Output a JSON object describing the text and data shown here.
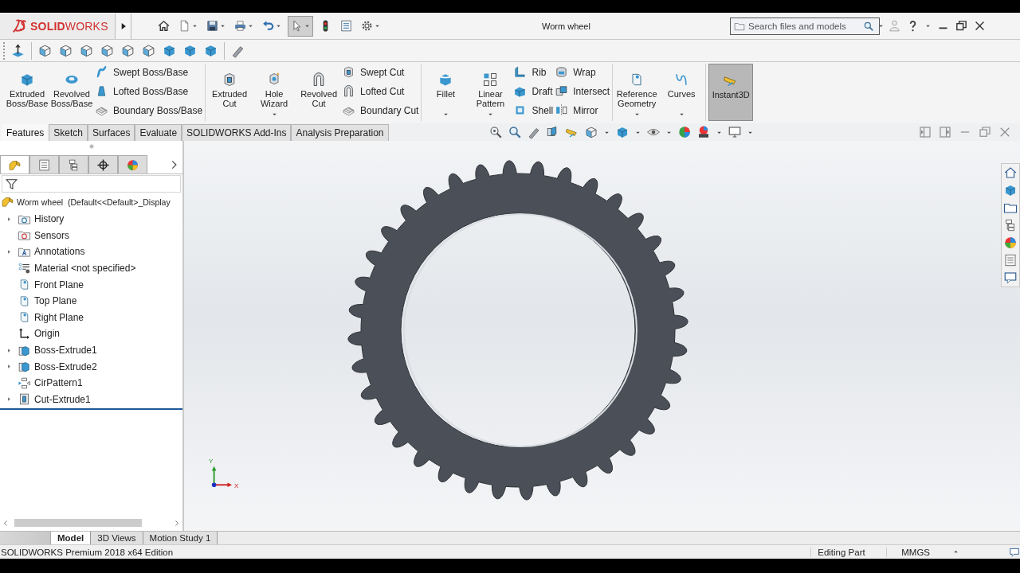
{
  "title_bar": {
    "logo": "**SOLID**WORKS",
    "title": "Worm wheel",
    "search": {
      "placeholder": "Search files and models"
    }
  },
  "quick_access": [
    {
      "dropdown": false,
      "pressed": false
    },
    {
      "dropdown": true,
      "pressed": false
    },
    {
      "dropdown": true,
      "pressed": false
    },
    {
      "dropdown": true,
      "pressed": false
    },
    {
      "dropdown": true,
      "pressed": false
    },
    {
      "dropdown": true,
      "pressed": true
    },
    {
      "dropdown": false,
      "pressed": false
    },
    {
      "dropdown": false,
      "pressed": false
    },
    {
      "dropdown": true,
      "pressed": false
    }
  ],
  "ribbon": {
    "groups": [
      {
        "items": [
          {
            "kind": "large",
            "label": "Extruded Boss/Base",
            "dropdown": false,
            "selected": false
          },
          {
            "kind": "large",
            "label": "Revolved Boss/Base",
            "dropdown": false,
            "selected": false
          },
          {
            "kind": "stack",
            "items": [
              {
                "label": "Swept Boss/Base"
              },
              {
                "label": "Lofted Boss/Base"
              },
              {
                "label": "Boundary Boss/Base"
              }
            ]
          }
        ]
      },
      {
        "items": [
          {
            "kind": "large",
            "label": "Extruded Cut",
            "dropdown": false,
            "selected": false
          },
          {
            "kind": "large",
            "label": "Hole Wizard",
            "dropdown": true,
            "selected": false
          },
          {
            "kind": "large",
            "label": "Revolved Cut",
            "dropdown": false,
            "selected": false
          },
          {
            "kind": "stack",
            "items": [
              {
                "label": "Swept Cut"
              },
              {
                "label": "Lofted Cut"
              },
              {
                "label": "Boundary Cut"
              }
            ]
          }
        ]
      },
      {
        "items": [
          {
            "kind": "large",
            "label": "Fillet",
            "dropdown": true,
            "selected": false
          },
          {
            "kind": "large",
            "label": "Linear Pattern",
            "dropdown": true,
            "selected": false
          },
          {
            "kind": "stack",
            "items": [
              {
                "label": "Rib"
              },
              {
                "label": "Draft"
              },
              {
                "label": "Shell"
              }
            ]
          },
          {
            "kind": "stack",
            "items": [
              {
                "label": "Wrap"
              },
              {
                "label": "Intersect"
              },
              {
                "label": "Mirror"
              }
            ]
          }
        ]
      },
      {
        "items": [
          {
            "kind": "large",
            "label": "Reference Geometry",
            "dropdown": true,
            "selected": false
          },
          {
            "kind": "large",
            "label": "Curves",
            "dropdown": true,
            "selected": false
          }
        ]
      },
      {
        "items": [
          {
            "kind": "large",
            "label": "Instant3D",
            "dropdown": false,
            "selected": true
          }
        ]
      }
    ]
  },
  "command_tabs": [
    {
      "label": "Features",
      "selected": true
    },
    {
      "label": "Sketch",
      "selected": false
    },
    {
      "label": "Surfaces",
      "selected": false
    },
    {
      "label": "Evaluate",
      "selected": false
    },
    {
      "label": "SOLIDWORKS Add-Ins",
      "selected": false
    },
    {
      "label": "Analysis Preparation",
      "selected": false
    }
  ],
  "panel_tabs": [
    {
      "selected": true
    },
    {
      "selected": false
    },
    {
      "selected": false
    },
    {
      "selected": false
    },
    {
      "selected": false
    }
  ],
  "feature_tree": {
    "root": "Worm wheel  (Default<<Default>_Display",
    "items": [
      {
        "label": "History",
        "expandable": true
      },
      {
        "label": "Sensors",
        "expandable": false
      },
      {
        "label": "Annotations",
        "expandable": true
      },
      {
        "label": "Material <not specified>",
        "expandable": false
      },
      {
        "label": "Front Plane",
        "expandable": false
      },
      {
        "label": "Top Plane",
        "expandable": false
      },
      {
        "label": "Right Plane",
        "expandable": false
      },
      {
        "label": "Origin",
        "expandable": false
      },
      {
        "label": "Boss-Extrude1",
        "expandable": true
      },
      {
        "label": "Boss-Extrude2",
        "expandable": true
      },
      {
        "label": "CirPattern1",
        "expandable": false
      },
      {
        "label": "Cut-Extrude1",
        "expandable": true
      }
    ]
  },
  "viewport": {
    "triad": {
      "y_label": "Y",
      "x_label": "X"
    }
  },
  "bottom_tabs": [
    {
      "label": "Model",
      "selected": true
    },
    {
      "label": "3D Views",
      "selected": false
    },
    {
      "label": "Motion Study 1",
      "selected": false
    }
  ],
  "status_bar": {
    "edition": "SOLIDWORKS Premium 2018 x64 Edition",
    "mode": "Editing Part",
    "units": "MMGS"
  }
}
